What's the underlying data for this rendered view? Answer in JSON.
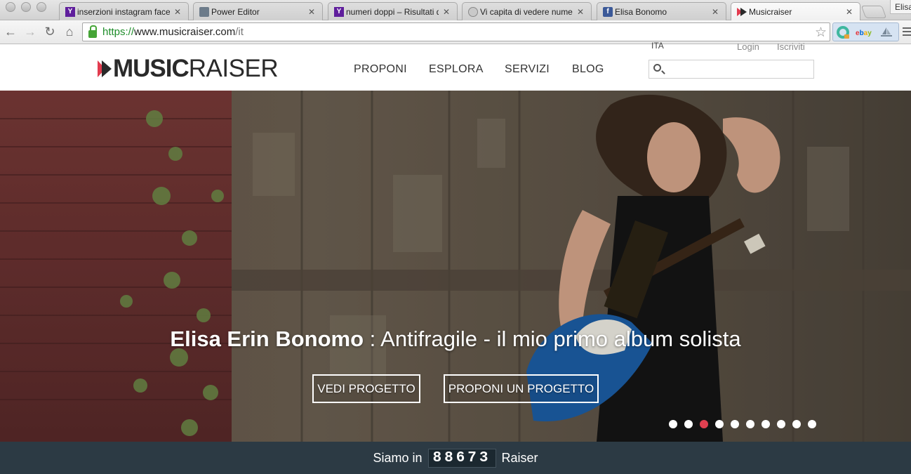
{
  "browser": {
    "tabs": [
      {
        "title": "inserzioni instagram faceb",
        "favicon": "yahoo-icon",
        "active": false
      },
      {
        "title": "Power Editor",
        "favicon": "document-icon",
        "active": false
      },
      {
        "title": "numeri doppi – Risultati di",
        "favicon": "yahoo-icon",
        "active": false
      },
      {
        "title": "Vi capita di vedere numeri",
        "favicon": "globe-icon",
        "active": false
      },
      {
        "title": "Elisa Bonomo",
        "favicon": "facebook-icon",
        "active": false
      },
      {
        "title": "Musicraiser",
        "favicon": "musicraiser-icon",
        "active": true
      }
    ],
    "user_label": "Elisa",
    "url": {
      "scheme": "https://",
      "host": "www.musicraiser.com",
      "path": "/it"
    },
    "extensions": [
      "grammarly-icon",
      "ebay-icon",
      "sailboat-icon"
    ],
    "colors": {
      "secure_green": "#1e8d2a",
      "yahoo_purple": "#5f1e9c",
      "facebook_blue": "#3b5998"
    }
  },
  "site": {
    "logo": {
      "bold": "MUSIC",
      "light": "RAISER"
    },
    "nav": [
      "PROPONI",
      "ESPLORA",
      "SERVIZI",
      "BLOG"
    ],
    "lang": "ITA",
    "login": "Login",
    "signup": "Iscriviti",
    "search": {
      "placeholder": "",
      "value": ""
    },
    "colors": {
      "brand_red": "#e23b4e",
      "footer_bg": "#2c3a44"
    }
  },
  "hero": {
    "artist": "Elisa Erin Bonomo",
    "separator": " : ",
    "project": "Antifragile - il mio primo album solista",
    "buttons": [
      "VEDI PROGETTO",
      "PROPONI UN PROGETTO"
    ],
    "slides": 10,
    "active_slide": 3
  },
  "counter": {
    "prefix": "Siamo in",
    "value": "88673",
    "suffix": "Raiser"
  }
}
